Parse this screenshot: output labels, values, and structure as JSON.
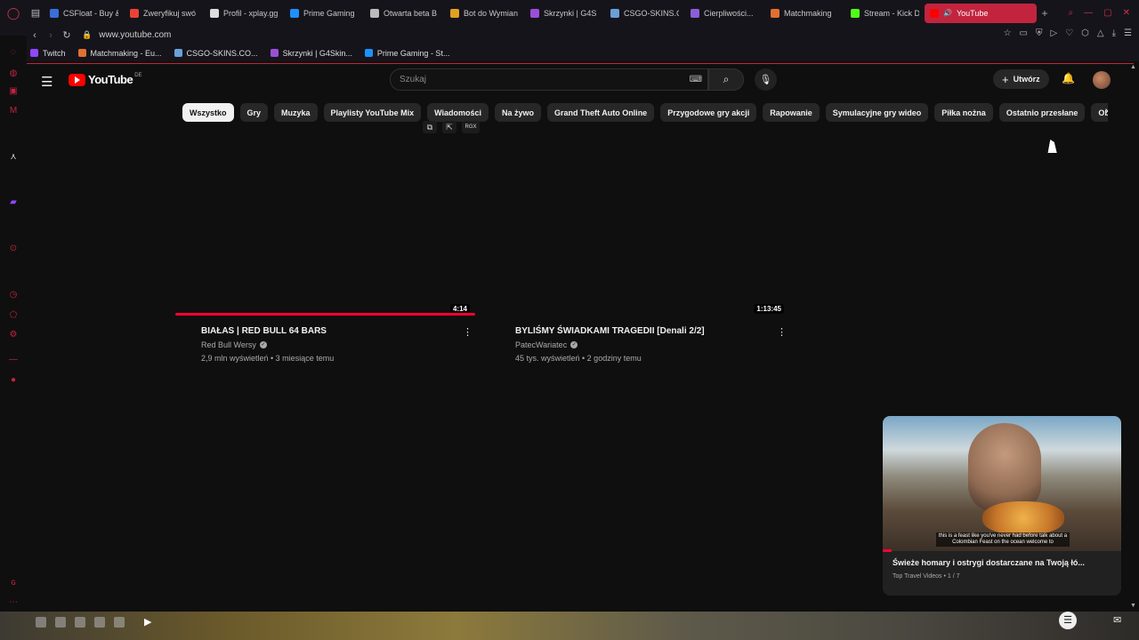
{
  "browser": {
    "tabs": [
      {
        "label": "CSFloat - Buy &",
        "color": "#3a6fd8"
      },
      {
        "label": "Zweryfikuj swó",
        "color": "#ea4335"
      },
      {
        "label": "Profil - xplay.gg",
        "color": "#dddddd"
      },
      {
        "label": "Prime Gaming",
        "color": "#1e90ff"
      },
      {
        "label": "Otwarta beta B",
        "color": "#bbbbbb"
      },
      {
        "label": "Bot do Wymian",
        "color": "#e0a020"
      },
      {
        "label": "Skrzynki | G4S",
        "color": "#9a4fd8"
      },
      {
        "label": "CSGO-SKINS.C",
        "color": "#6aa0d8"
      },
      {
        "label": "Cierpliwości...",
        "color": "#8a5fd8"
      },
      {
        "label": "Matchmaking",
        "color": "#e07030"
      },
      {
        "label": "Stream - Kick D",
        "color": "#53fc18"
      }
    ],
    "active_tab": {
      "label": "YouTube",
      "color": "#ff0000"
    },
    "url": "www.youtube.com",
    "bookmarks": [
      {
        "label": "Twitch",
        "color": "#9146ff"
      },
      {
        "label": "Matchmaking - Eu...",
        "color": "#e07030"
      },
      {
        "label": "CSGO-SKINS.CO...",
        "color": "#6aa0d8"
      },
      {
        "label": "Skrzynki | G4Skin...",
        "color": "#9a4fd8"
      },
      {
        "label": "Prime Gaming - St...",
        "color": "#1e90ff"
      }
    ]
  },
  "youtube": {
    "logo_text": "YouTube",
    "region": "DE",
    "search_placeholder": "Szukaj",
    "create_label": "Utwórz",
    "chips": [
      "Wszystko",
      "Gry",
      "Muzyka",
      "Playlisty YouTube Mix",
      "Wiadomości",
      "Na żywo",
      "Grand Theft Auto Online",
      "Przygodowe gry akcji",
      "Rapowanie",
      "Symulacyjne gry wideo",
      "Piłka nożna",
      "Ostatnio przesłane",
      "Obe"
    ],
    "mini_tools_label": "RGX",
    "videos": [
      {
        "title": "BIAŁAS | RED BULL 64 BARS",
        "channel": "Red Bull Wersy",
        "meta": "2,9 mln wyświetleń • 3 miesiące temu",
        "duration": "4:14",
        "watched_fraction": 1.0
      },
      {
        "title": "BYLIŚMY ŚWIADKAMI TRAGEDII [Denali 2/2]",
        "channel": "PatecWariatec",
        "meta": "45 tys. wyświetleń • 2 godziny temu",
        "duration": "1:13:45",
        "watched_fraction": 0
      }
    ],
    "miniplayer": {
      "subtitle": "this is a feast like you've never had before talk about a Colombian Feast on the ocean welcome to",
      "title": "Świeże homary i ostrygi dostarczane na Twoją łó...",
      "channel": "Top Travel Videos • 1 / 7"
    }
  }
}
